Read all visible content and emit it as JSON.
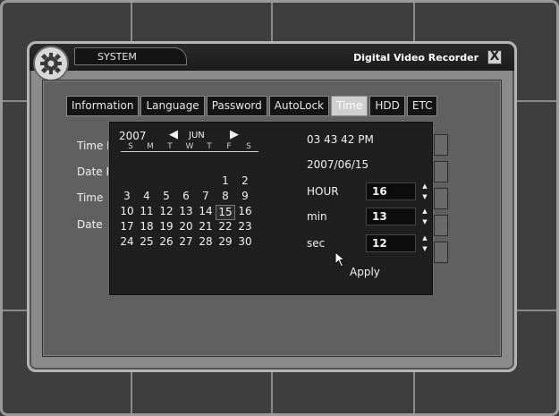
{
  "window": {
    "system_tab": "SYSTEM",
    "title": "Digital Video Recorder",
    "close_glyph": "X",
    "icon": "gear-icon"
  },
  "tabs": [
    {
      "label": "Information",
      "active": false
    },
    {
      "label": "Language",
      "active": false
    },
    {
      "label": "Password",
      "active": false
    },
    {
      "label": "AutoLock",
      "active": false
    },
    {
      "label": "Time",
      "active": true
    },
    {
      "label": "HDD",
      "active": false
    },
    {
      "label": "ETC",
      "active": false
    }
  ],
  "behind_labels": [
    "Time I",
    "Date I",
    "Time",
    "Date"
  ],
  "calendar": {
    "year": "2007",
    "month": "JUN",
    "prev_icon": "triangle-left-icon",
    "next_icon": "triangle-right-icon",
    "weekdays": [
      "S",
      "M",
      "T",
      "W",
      "T",
      "F",
      "S"
    ],
    "weeks": [
      [
        "",
        "",
        "",
        "",
        "",
        "1",
        "2"
      ],
      [
        "3",
        "4",
        "5",
        "6",
        "7",
        "8",
        "9"
      ],
      [
        "10",
        "11",
        "12",
        "13",
        "14",
        "15",
        "16"
      ],
      [
        "17",
        "18",
        "19",
        "20",
        "21",
        "22",
        "23"
      ],
      [
        "24",
        "25",
        "26",
        "27",
        "28",
        "29",
        "30"
      ]
    ],
    "selected_day": "15"
  },
  "clock": "03 43 42 PM",
  "date": "2007/06/15",
  "fields": [
    {
      "label": "HOUR",
      "value": "16"
    },
    {
      "label": "min",
      "value": "13"
    },
    {
      "label": "sec",
      "value": "12"
    }
  ],
  "apply_label": "Apply",
  "colors": {
    "window_bg": "#8b8b8b",
    "panel_bg": "#606060",
    "popup_bg": "#1f1f1f",
    "active_tab": "#cfcfcf"
  }
}
